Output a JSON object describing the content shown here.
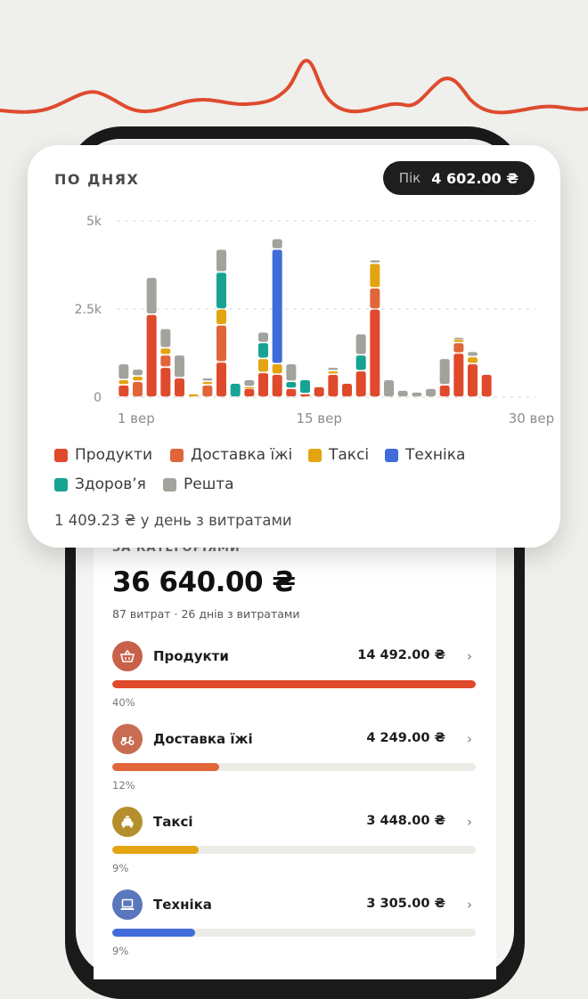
{
  "card": {
    "title": "ПО ДНЯХ",
    "peak_label": "Пік",
    "peak_value": "4 602.00 ₴",
    "legend": [
      {
        "label": "Продукти",
        "color": "#e04a2c"
      },
      {
        "label": "Доставка їжі",
        "color": "#e0663a"
      },
      {
        "label": "Таксі",
        "color": "#e3a410"
      },
      {
        "label": "Техніка",
        "color": "#3f6cd8"
      },
      {
        "label": "Здоров’я",
        "color": "#16a394"
      },
      {
        "label": "Решта",
        "color": "#a3a29c"
      }
    ],
    "daily_avg": "1 409.23 ₴ у день з витратами"
  },
  "chart_data": {
    "type": "bar",
    "stacked": true,
    "title": "ПО ДНЯХ",
    "x_tick_labels": [
      "1 вер",
      "15 вер",
      "30 вер"
    ],
    "y_tick_labels": [
      "0",
      "2.5k",
      "5k"
    ],
    "ylim": [
      0,
      5000
    ],
    "grid": true,
    "legend_position": "bottom",
    "categories": [
      "1",
      "2",
      "3",
      "4",
      "5",
      "6",
      "7",
      "8",
      "9",
      "10",
      "11",
      "12",
      "13",
      "14",
      "15",
      "16",
      "17",
      "18",
      "19",
      "20",
      "21",
      "22",
      "23",
      "24",
      "25",
      "26",
      "27",
      "28",
      "29",
      "30"
    ],
    "series": [
      {
        "name": "Продукти",
        "color": "#e04a2c",
        "values": [
          350,
          0,
          2350,
          850,
          550,
          0,
          0,
          1000,
          0,
          250,
          700,
          650,
          250,
          100,
          300,
          650,
          400,
          750,
          2500,
          0,
          0,
          0,
          0,
          350,
          1250,
          950,
          650,
          0,
          0,
          0
        ]
      },
      {
        "name": "Доставка їжі",
        "color": "#e0663a",
        "values": [
          0,
          450,
          0,
          350,
          0,
          0,
          350,
          1050,
          0,
          0,
          0,
          0,
          0,
          0,
          0,
          0,
          0,
          0,
          600,
          0,
          0,
          0,
          0,
          0,
          300,
          0,
          0,
          0,
          0,
          0
        ]
      },
      {
        "name": "Таксі",
        "color": "#e3a410",
        "values": [
          150,
          150,
          0,
          200,
          0,
          100,
          100,
          450,
          0,
          50,
          400,
          300,
          0,
          0,
          0,
          100,
          0,
          0,
          700,
          0,
          0,
          0,
          0,
          0,
          100,
          200,
          0,
          0,
          0,
          0
        ]
      },
      {
        "name": "Техніка",
        "color": "#3f6cd8",
        "values": [
          0,
          0,
          0,
          0,
          0,
          0,
          0,
          0,
          0,
          0,
          0,
          3250,
          0,
          0,
          0,
          0,
          0,
          0,
          0,
          0,
          0,
          0,
          0,
          0,
          0,
          0,
          0,
          0,
          0,
          0
        ]
      },
      {
        "name": "Здоров’я",
        "color": "#16a394",
        "values": [
          0,
          0,
          0,
          0,
          0,
          0,
          0,
          1050,
          400,
          0,
          450,
          0,
          200,
          400,
          0,
          0,
          0,
          450,
          0,
          0,
          0,
          0,
          0,
          0,
          0,
          0,
          0,
          0,
          0,
          0
        ]
      },
      {
        "name": "Решта",
        "color": "#a3a29c",
        "values": [
          450,
          200,
          1050,
          550,
          650,
          0,
          100,
          650,
          0,
          200,
          300,
          300,
          500,
          0,
          0,
          100,
          0,
          600,
          100,
          500,
          200,
          150,
          250,
          750,
          50,
          150,
          0,
          0,
          0,
          0
        ]
      }
    ]
  },
  "categories_section": {
    "title": "ЗА КАТЕГОРІЯМИ",
    "total": "36 640.00 ₴",
    "subtitle": "87 витрат · 26 днів з витратами",
    "items": [
      {
        "name": "Продукти",
        "amount": "14 492.00 ₴",
        "percent_label": "40%",
        "share": 1.0,
        "color": "#e04a2c",
        "icon_bg": "#c9604a",
        "icon": "basket-icon"
      },
      {
        "name": "Доставка їжі",
        "amount": "4 249.00 ₴",
        "percent_label": "12%",
        "share": 0.293,
        "color": "#e0663a",
        "icon_bg": "#c86c52",
        "icon": "scooter-icon"
      },
      {
        "name": "Таксі",
        "amount": "3 448.00 ₴",
        "percent_label": "9%",
        "share": 0.238,
        "color": "#e3a410",
        "icon_bg": "#b48f2c",
        "icon": "taxi-icon"
      },
      {
        "name": "Техніка",
        "amount": "3 305.00 ₴",
        "percent_label": "9%",
        "share": 0.228,
        "color": "#3f6cd8",
        "icon_bg": "#5a77bd",
        "icon": "laptop-icon"
      }
    ]
  },
  "icons": {
    "chevron": "›"
  }
}
